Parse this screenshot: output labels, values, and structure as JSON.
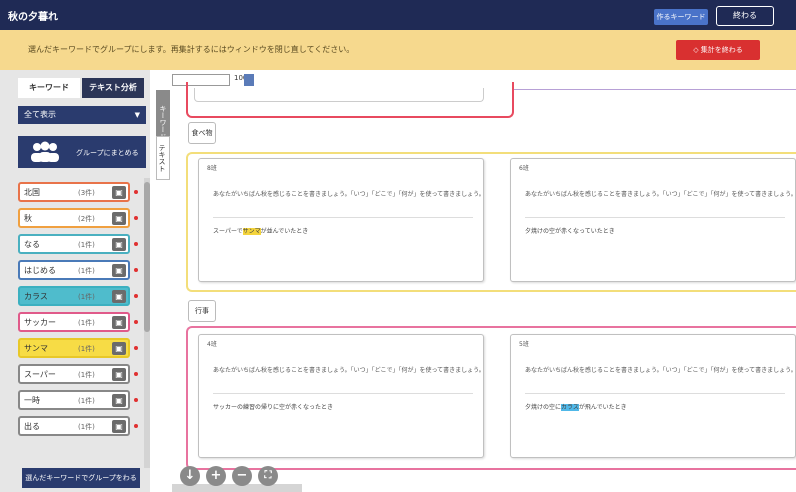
{
  "titlebar": {
    "title": "秋の夕暮れ",
    "blue_button": "作るキーワード",
    "close_button": "終わる"
  },
  "banner": {
    "message": "選んだキーワードでグループにします。再集計するにはウィンドウを閉じ直してください。",
    "red_button": "◇ 集計を終わる"
  },
  "sidebar": {
    "tab_keyword": "キーワード",
    "tab_text": "テキスト分析",
    "select_value": "全て表示",
    "group_button": "グループにまとめる",
    "vtab_1": "キーワード",
    "vtab_2": "テキスト",
    "keywords": [
      {
        "word": "北国",
        "count": "(3件)",
        "color": "#e8734a",
        "bg": "#ffffff"
      },
      {
        "word": "秋",
        "count": "(2件)",
        "color": "#f0a040",
        "bg": "#ffffff"
      },
      {
        "word": "なる",
        "count": "(1件)",
        "color": "#4ab0c0",
        "bg": "#ffffff"
      },
      {
        "word": "はじめる",
        "count": "(1件)",
        "color": "#4a7ab8",
        "bg": "#ffffff"
      },
      {
        "word": "カラス",
        "count": "(1件)",
        "color": "#3cb0c0",
        "bg": "#4fbccc"
      },
      {
        "word": "サッカー",
        "count": "(1件)",
        "color": "#e05a8a",
        "bg": "#ffffff"
      },
      {
        "word": "サンマ",
        "count": "(1件)",
        "color": "#e8c828",
        "bg": "#f7dc45"
      },
      {
        "word": "スーパー",
        "count": "(1件)",
        "color": "#888888",
        "bg": "#ffffff"
      },
      {
        "word": "一時",
        "count": "(1件)",
        "color": "#888888",
        "bg": "#ffffff"
      },
      {
        "word": "出る",
        "count": "(1件)",
        "color": "#888888",
        "bg": "#ffffff"
      }
    ],
    "bottom_button": "選んだキーワードでグループをわる"
  },
  "toolbar": {
    "input_value": "",
    "num": "100"
  },
  "groups": [
    {
      "label": "食べ物",
      "cards": [
        {
          "tag": "8班",
          "question": "あなたがいちばん秋を感じることを書きましょう。「いつ」「どこで」「何が」を使って書きましょう。",
          "answer_pre": "スーパーで",
          "answer_hl": "サンマ",
          "answer_post": "が並んでいたとき"
        },
        {
          "tag": "6班",
          "question": "あなたがいちばん秋を感じることを書きましょう。「いつ」「どこで」「何が」を使って書きましょう。",
          "answer_pre": "夕焼けの空が赤くなっていたとき",
          "answer_hl": "",
          "answer_post": ""
        }
      ]
    },
    {
      "label": "行事",
      "cards": [
        {
          "tag": "4班",
          "question": "あなたがいちばん秋を感じることを書きましょう。「いつ」「どこで」「何が」を使って書きましょう。",
          "answer_pre": "サッカーの練習の帰りに空が赤くなったとき",
          "answer_hl": "",
          "answer_post": ""
        },
        {
          "tag": "5班",
          "question": "あなたがいちばん秋を感じることを書きましょう。「いつ」「どこで」「何が」を使って書きましょう。",
          "answer_pre": "夕焼けの空に",
          "answer_hl": "カラス",
          "answer_post": "が飛んでいたとき"
        }
      ]
    }
  ],
  "zoom": {
    "down": "↓",
    "plus": "+",
    "minus": "−",
    "fit": "⛶"
  }
}
